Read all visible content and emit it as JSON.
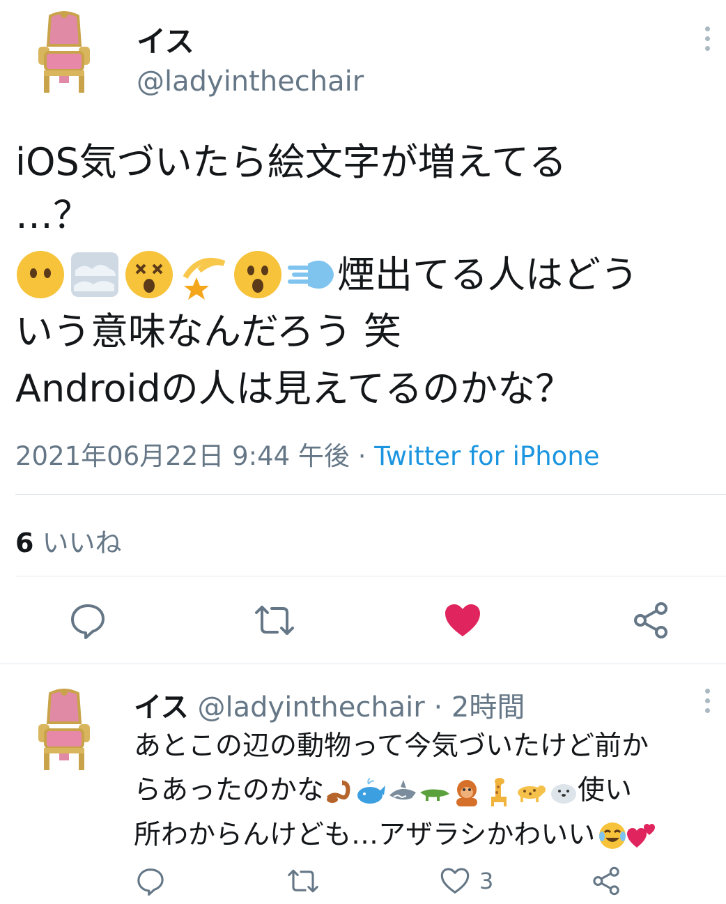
{
  "main_tweet": {
    "author_name": "イス",
    "author_handle": "@ladyinthechair",
    "text_line1": "iOS気づいたら絵文字が増えてる",
    "text_line2": "…？",
    "text_line3_suffix": "煙出てる人はどう",
    "text_line4": "いう意味なんだろう 笑",
    "text_line5": "Androidの人は見えてるのかな？",
    "emojis": [
      "face-without-mouth-icon",
      "fog-icon",
      "dizzy-face-icon",
      "dizzy-star-icon",
      "face-open-mouth-icon",
      "dash-icon"
    ],
    "timestamp": "2021年06月22日 9:44 午後",
    "separator": " · ",
    "source": "Twitter for iPhone",
    "likes_count": "6",
    "likes_label": "いいね",
    "liked": true
  },
  "reply_tweet": {
    "author_name": "イス",
    "author_handle": "@ladyinthechair",
    "time": "· 2時間",
    "text_line1": "あとこの辺の動物って今気づいたけど前か",
    "text_line2_prefix": "らあったのかな",
    "text_line2_suffix": "使い",
    "text_line3": "所わからんけども…アザラシかわいい",
    "animal_emojis": [
      "scorpion-icon",
      "whale-icon",
      "shark-icon",
      "crocodile-icon",
      "orangutan-icon",
      "giraffe-icon",
      "leopard-icon",
      "seal-icon"
    ],
    "end_emojis": [
      "laugh-crying-icon",
      "two-hearts-icon"
    ],
    "like_count": "3"
  },
  "colors": {
    "accent": "#1b95e0",
    "like": "#e0245e",
    "gray": "#657786"
  }
}
